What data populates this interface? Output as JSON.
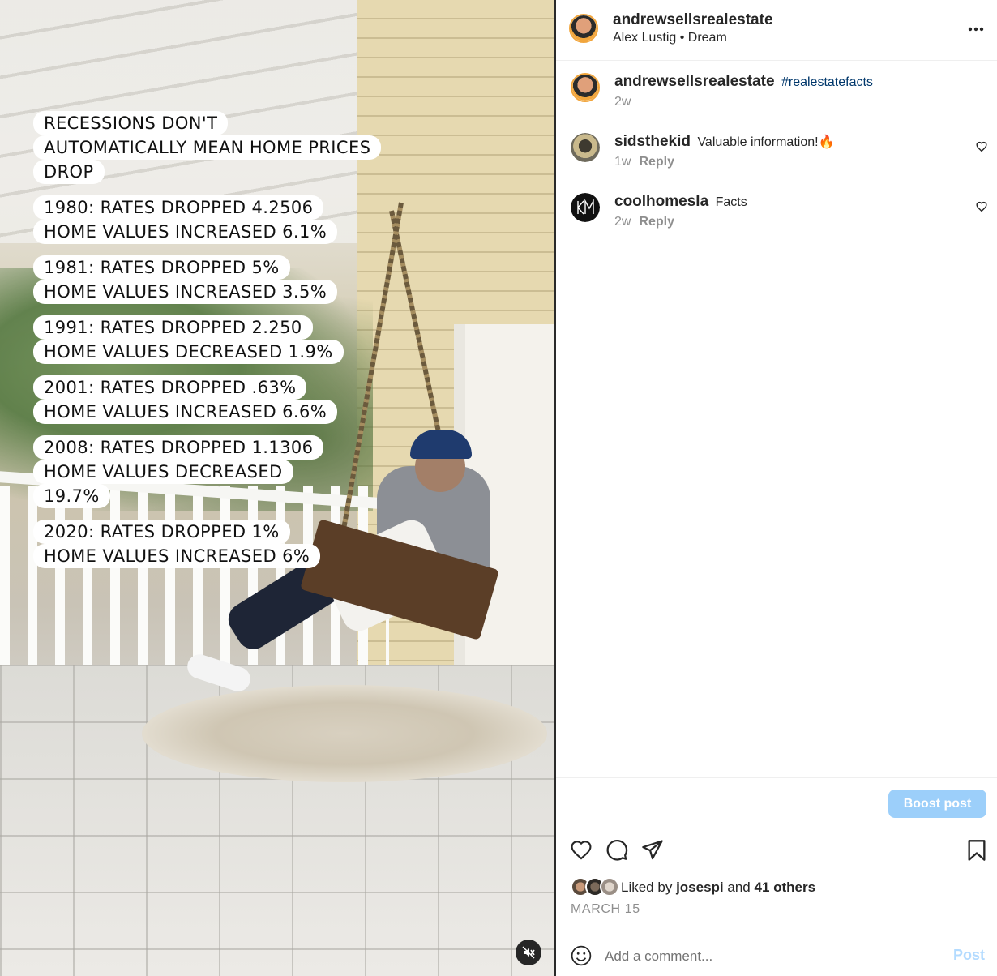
{
  "post": {
    "username": "andrewsellsrealestate",
    "audio": "Alex Lustig • Dream",
    "more_label": "···"
  },
  "video": {
    "caption_blocks": [
      [
        "RECESSIONS DON'T",
        "AUTOMATICALLY MEAN HOME PRICES",
        "DROP"
      ],
      [
        "1980: RATES DROPPED 4.2506",
        "HOME VALUES INCREASED 6.1%"
      ],
      [
        "1981: RATES DROPPED 5%",
        "HOME VALUES INCREASED 3.5%"
      ],
      [
        "1991: RATES DROPPED 2.250",
        "HOME VALUES DECREASED 1.9%"
      ],
      [
        "2001: RATES DROPPED .63%",
        "HOME VALUES INCREASED 6.6%"
      ],
      [
        "2008: RATES DROPPED 1.1306",
        "HOME VALUES DECREASED",
        "19.7%"
      ],
      [
        "2020: RATES DROPPED 1%",
        "HOME VALUES INCREASED 6%"
      ]
    ],
    "muted": true
  },
  "comments": [
    {
      "username": "andrewsellsrealestate",
      "text": "#realestatefacts",
      "is_hashtag": true,
      "time": "2w",
      "reply": ""
    },
    {
      "username": "sidsthekid",
      "text": "Valuable information!🔥",
      "is_hashtag": false,
      "time": "1w",
      "reply": "Reply"
    },
    {
      "username": "coolhomesla",
      "text": "Facts",
      "is_hashtag": false,
      "time": "2w",
      "reply": "Reply"
    }
  ],
  "boost": {
    "label": "Boost post",
    "color": "#9ccffa"
  },
  "likes": {
    "prefix": "Liked by",
    "user": "josespi",
    "conj": "and",
    "others": "41 others"
  },
  "date": "MARCH 15",
  "comment_box": {
    "placeholder": "Add a comment...",
    "post_label": "Post"
  },
  "colors": {
    "accent_link": "#00376b",
    "post_disabled": "#b3dbff",
    "avatar_ring": "#f1a53c"
  },
  "icons": [
    "heart-icon",
    "comment-icon",
    "share-icon",
    "bookmark-icon",
    "emoji-icon",
    "mute-icon",
    "more-icon"
  ]
}
